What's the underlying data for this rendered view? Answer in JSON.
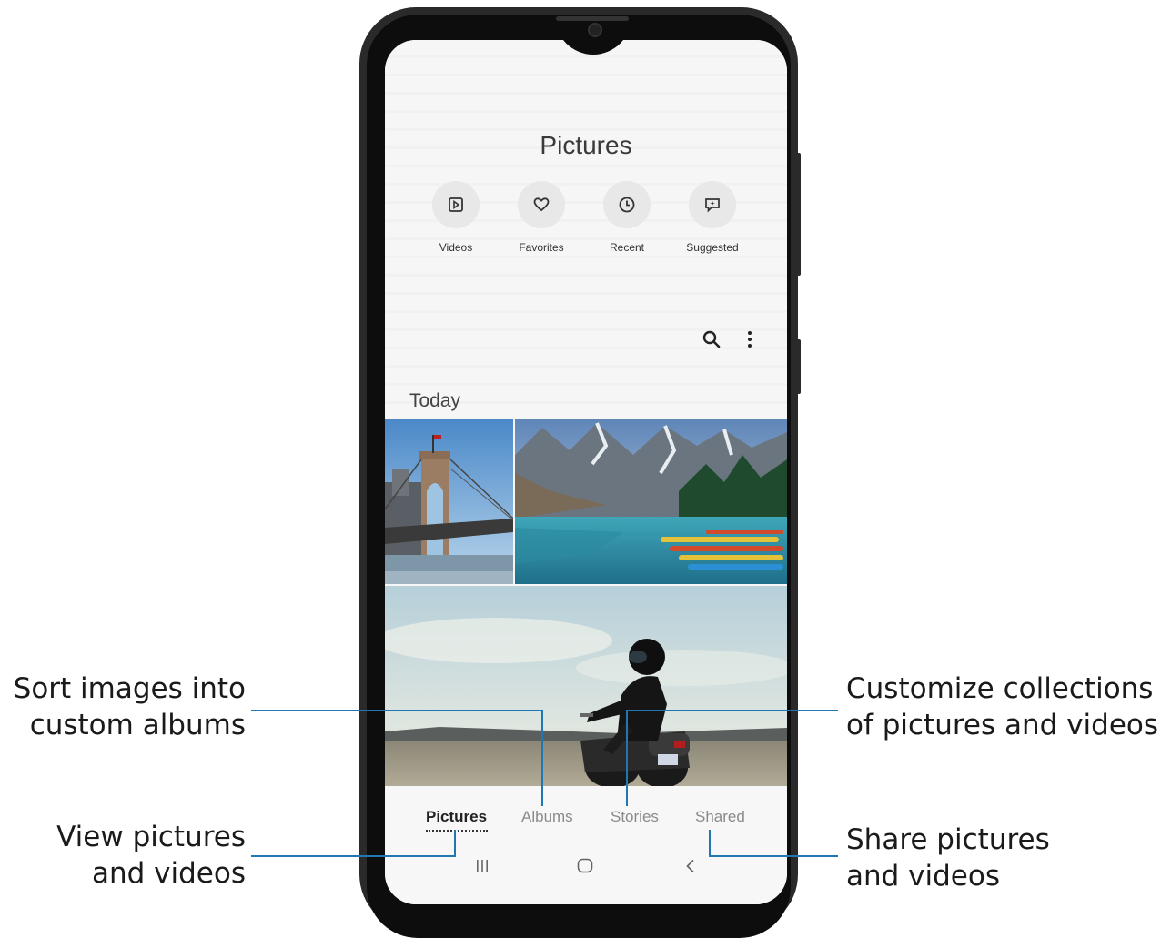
{
  "callouts": {
    "sort_albums": "Sort images into\ncustom albums",
    "view_pictures": "View pictures\nand videos",
    "customize": "Customize collections\nof pictures and videos",
    "share": "Share pictures\nand videos"
  },
  "gallery": {
    "title": "Pictures",
    "quick_access": [
      {
        "label": "Videos",
        "icon": "video-icon"
      },
      {
        "label": "Favorites",
        "icon": "heart-icon"
      },
      {
        "label": "Recent",
        "icon": "clock-icon"
      },
      {
        "label": "Suggested",
        "icon": "suggested-icon"
      }
    ],
    "section_label": "Today",
    "photos": [
      "brooklyn-bridge",
      "mountain-lake-canoes",
      "motorcycle-rider"
    ]
  },
  "bottom_tabs": [
    {
      "label": "Pictures",
      "active": true
    },
    {
      "label": "Albums",
      "active": false
    },
    {
      "label": "Stories",
      "active": false
    },
    {
      "label": "Shared",
      "active": false
    }
  ],
  "colors": {
    "leader": "#1f78b4",
    "active_tab": "#222222"
  }
}
